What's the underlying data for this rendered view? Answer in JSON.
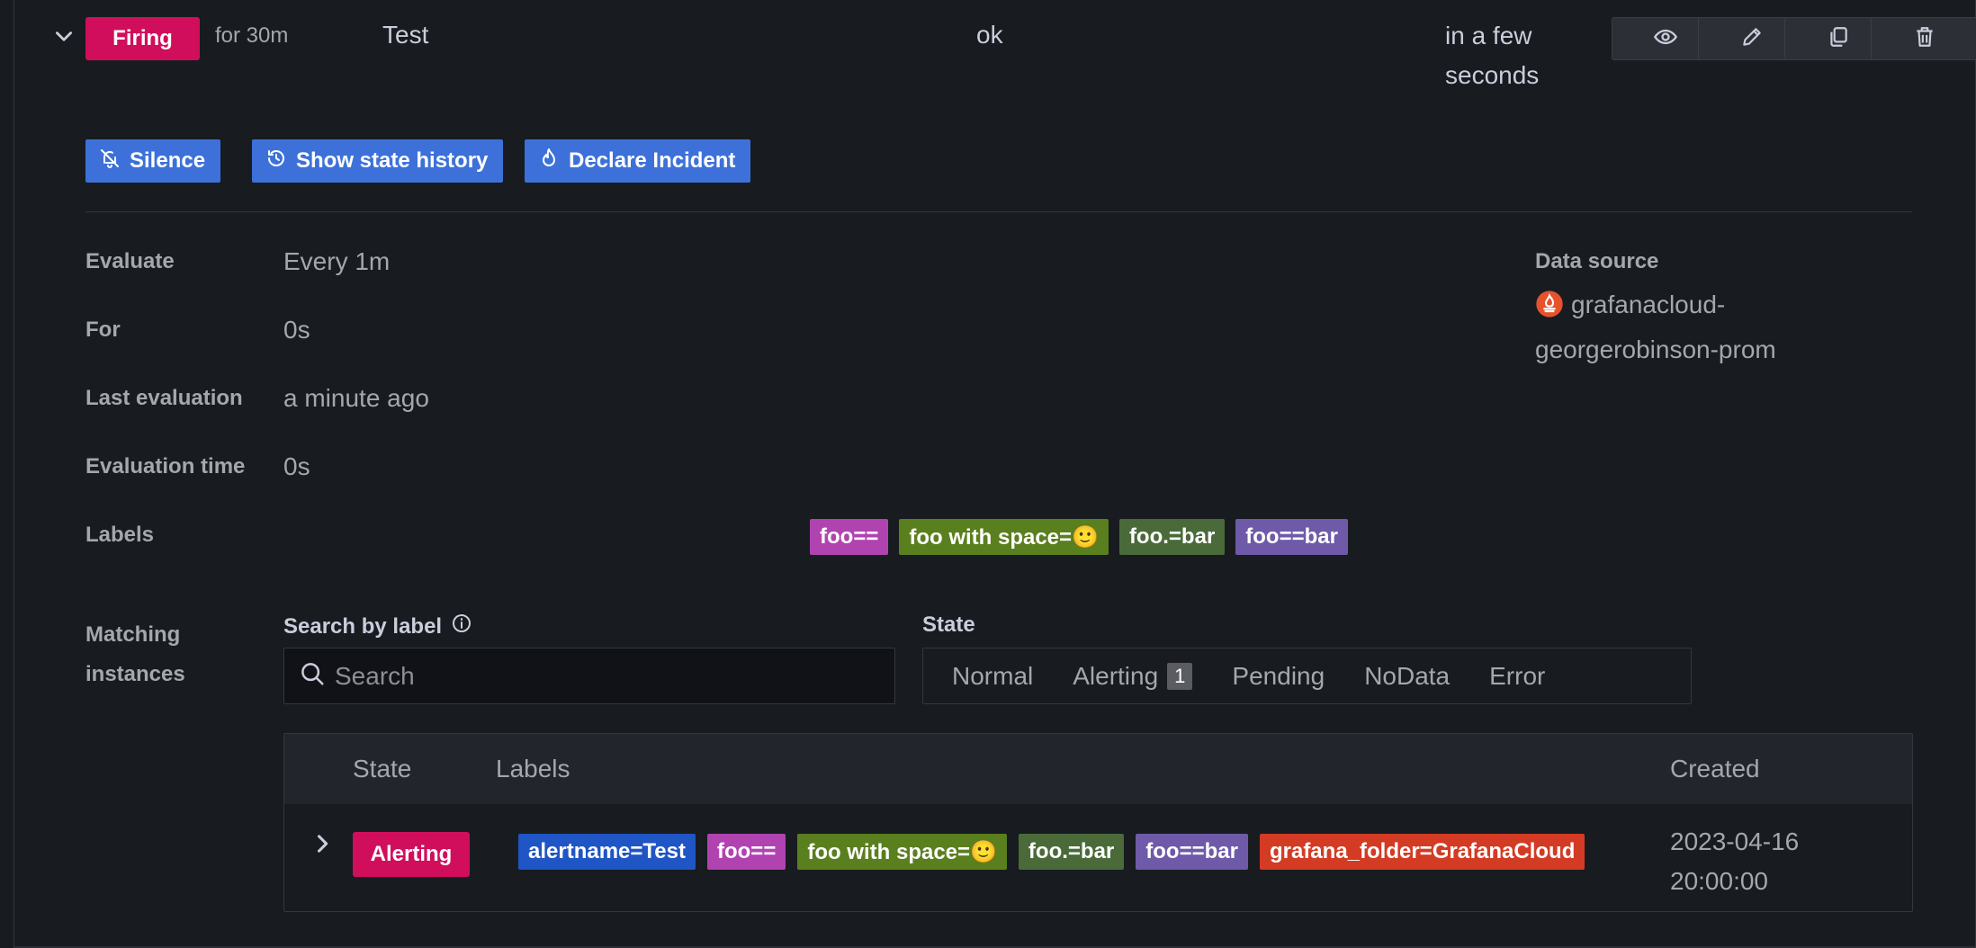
{
  "rule": {
    "state": "Firing",
    "for": "for 30m",
    "name": "Test",
    "health": "ok",
    "next_evaluation": "in a few seconds"
  },
  "actions": {
    "silence": "Silence",
    "state_history": "Show state history",
    "declare_incident": "Declare Incident"
  },
  "details": {
    "evaluate_label": "Evaluate",
    "evaluate_value": "Every 1m",
    "for_label": "For",
    "for_value": "0s",
    "last_eval_label": "Last evaluation",
    "last_eval_value": "a minute ago",
    "eval_time_label": "Evaluation time",
    "eval_time_value": "0s",
    "labels_label": "Labels",
    "labels": [
      "foo==",
      "foo with space=🙂",
      "foo.=bar",
      "foo==bar"
    ],
    "data_source_label": "Data source",
    "data_source_value": "grafanacloud-georgerobinson-prom"
  },
  "instances": {
    "section_label": "Matching instances",
    "search_label": "Search by label",
    "search_placeholder": "Search",
    "state_label": "State",
    "state_options": [
      "Normal",
      "Alerting",
      "Pending",
      "NoData",
      "Error"
    ],
    "alerting_count": "1",
    "columns": [
      "State",
      "Labels",
      "Created"
    ],
    "rows": [
      {
        "state": "Alerting",
        "labels": [
          "alertname=Test",
          "foo==",
          "foo with space=🙂",
          "foo.=bar",
          "foo==bar",
          "grafana_folder=GrafanaCloud"
        ],
        "created": "2023-04-16 20:00:00"
      }
    ]
  },
  "colors": {
    "firing": "#d10e5c",
    "primary": "#3d71d9",
    "tag_purple": "#b143b1",
    "tag_olive": "#5a7f1e",
    "tag_green": "#4a6a3a",
    "tag_violet": "#6e5aa8",
    "tag_blue": "#1f55c4",
    "tag_red": "#d33b24"
  },
  "icons": [
    "chevron-down-icon",
    "eye-icon",
    "pencil-icon",
    "copy-icon",
    "trash-icon",
    "bell-slash-icon",
    "history-icon",
    "fire-icon",
    "prometheus-icon",
    "info-icon",
    "search-icon",
    "chevron-right-icon"
  ]
}
